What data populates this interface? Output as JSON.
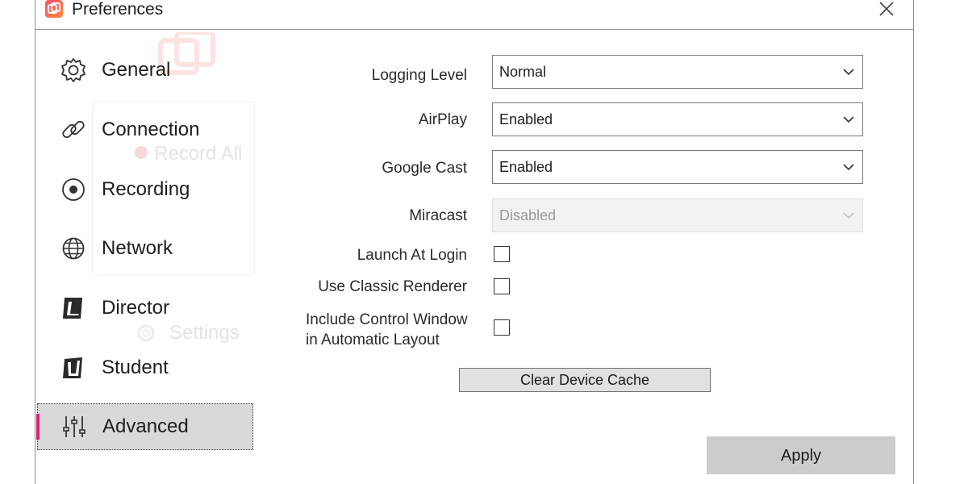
{
  "window": {
    "title": "Preferences"
  },
  "ghost": {
    "record_all": "Record All",
    "settings": "Settings"
  },
  "sidebar": {
    "items": [
      {
        "label": "General",
        "icon": "gear-icon"
      },
      {
        "label": "Connection",
        "icon": "link-icon"
      },
      {
        "label": "Recording",
        "icon": "record-icon"
      },
      {
        "label": "Network",
        "icon": "globe-icon"
      },
      {
        "label": "Director",
        "icon": "director-icon"
      },
      {
        "label": "Student",
        "icon": "student-icon"
      },
      {
        "label": "Advanced",
        "icon": "sliders-icon",
        "selected": true
      }
    ]
  },
  "settings": {
    "logging_level": {
      "label": "Logging Level",
      "value": "Normal"
    },
    "airplay": {
      "label": "AirPlay",
      "value": "Enabled"
    },
    "google_cast": {
      "label": "Google Cast",
      "value": "Enabled"
    },
    "miracast": {
      "label": "Miracast",
      "value": "Disabled",
      "disabled": true
    },
    "launch_at_login": {
      "label": "Launch At Login",
      "checked": false
    },
    "classic_renderer": {
      "label": "Use Classic Renderer",
      "checked": false
    },
    "control_window": {
      "label_line1": "Include Control Window",
      "label_line2": "in Automatic Layout",
      "checked": false
    }
  },
  "buttons": {
    "clear_cache": "Clear Device Cache",
    "apply": "Apply"
  },
  "colors": {
    "accent": "#d6247a",
    "brand_gradient_start": "#ff4f6d",
    "brand_gradient_end": "#ff8a3d"
  }
}
